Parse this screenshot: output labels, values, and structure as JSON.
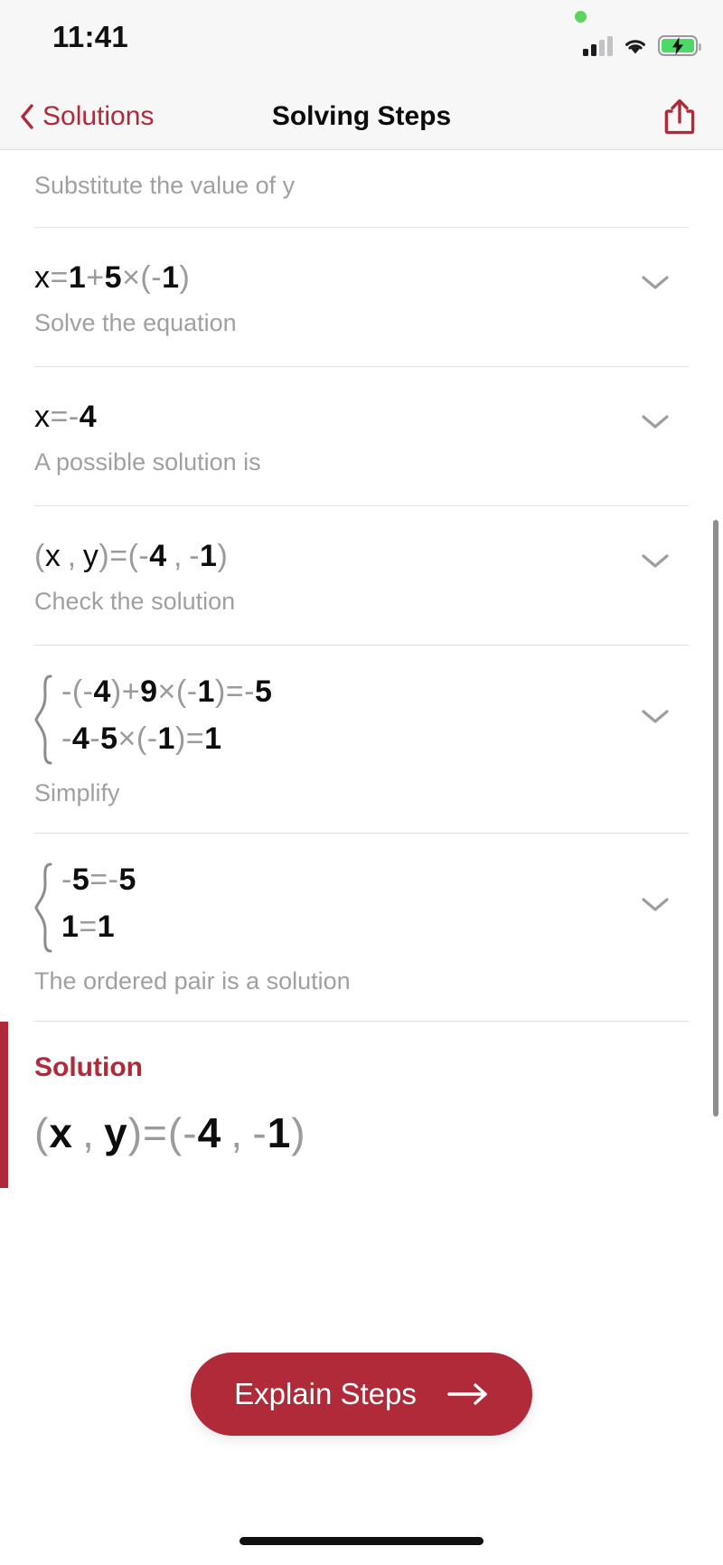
{
  "status_bar": {
    "time": "11:41",
    "icons": [
      "privacy-dot",
      "cellular-signal",
      "wifi",
      "battery-charging"
    ]
  },
  "nav": {
    "back_label": "Solutions",
    "title": "Solving Steps",
    "share_icon": "share-icon"
  },
  "steps": [
    {
      "expression_parts": [],
      "caption": "Substitute the value of y",
      "partial": true
    },
    {
      "expression": "x=1+5×(-1)",
      "caption": "Solve the equation",
      "chevron": "chevron-down-icon"
    },
    {
      "expression": "x=-4",
      "caption": "A possible solution is",
      "chevron": "chevron-down-icon"
    },
    {
      "expression": "(x , y)=(-4 , -1)",
      "caption": "Check the solution",
      "chevron": "chevron-down-icon"
    },
    {
      "system": [
        "-(-4)+9×(-1)=-5",
        "-4-5×(-1)=1"
      ],
      "caption": "Simplify",
      "chevron": "chevron-down-icon"
    },
    {
      "system": [
        "-5=-5",
        "1=1"
      ],
      "caption": "The ordered pair is a solution",
      "chevron": "chevron-down-icon"
    }
  ],
  "solution": {
    "title": "Solution",
    "expression": "(x , y)=(-4 , -1)",
    "accent_color": "#b02a3a"
  },
  "cta": {
    "label": "Explain Steps",
    "arrow_icon": "arrow-right-icon",
    "background_color": "#b02a3a"
  }
}
